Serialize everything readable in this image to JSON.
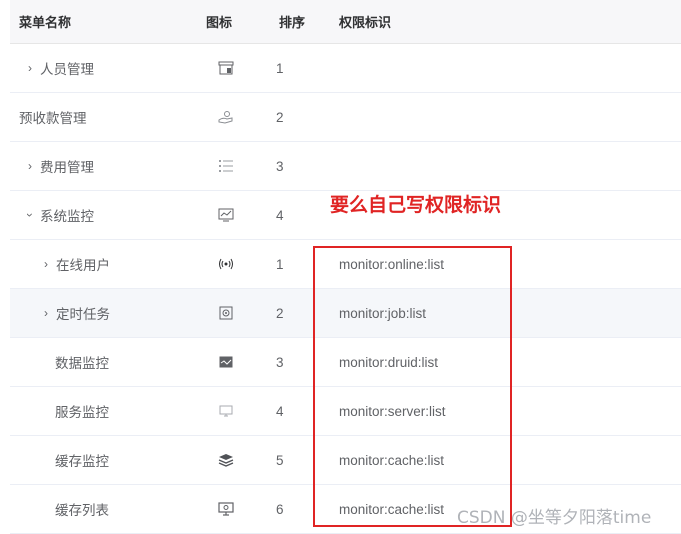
{
  "columns": {
    "name": "菜单名称",
    "icon": "图标",
    "order": "排序",
    "perm": "权限标识"
  },
  "rows": [
    {
      "name": "人员管理",
      "order": "1",
      "perm": "",
      "icon": "store-icon"
    },
    {
      "name": "预收款管理",
      "order": "2",
      "perm": "",
      "icon": "hand-money-icon"
    },
    {
      "name": "费用管理",
      "order": "3",
      "perm": "",
      "icon": "list-icon"
    },
    {
      "name": "系统监控",
      "order": "4",
      "perm": "",
      "icon": "monitor-chart-icon"
    },
    {
      "name": "在线用户",
      "order": "1",
      "perm": "monitor:online:list",
      "icon": "signal-icon"
    },
    {
      "name": "定时任务",
      "order": "2",
      "perm": "monitor:job:list",
      "icon": "job-icon"
    },
    {
      "name": "数据监控",
      "order": "3",
      "perm": "monitor:druid:list",
      "icon": "data-monitor-icon"
    },
    {
      "name": "服务监控",
      "order": "4",
      "perm": "monitor:server:list",
      "icon": "server-icon"
    },
    {
      "name": "缓存监控",
      "order": "5",
      "perm": "monitor:cache:list",
      "icon": "layers-icon"
    },
    {
      "name": "缓存列表",
      "order": "6",
      "perm": "monitor:cache:list",
      "icon": "screen-icon"
    }
  ],
  "annotation": "要么自己写权限标识",
  "watermark": "CSDN @坐等夕阳落time",
  "colors": {
    "annotation": "#e02424",
    "header_bg": "#f7f7f9",
    "highlight_bg": "#f5f7fa"
  }
}
